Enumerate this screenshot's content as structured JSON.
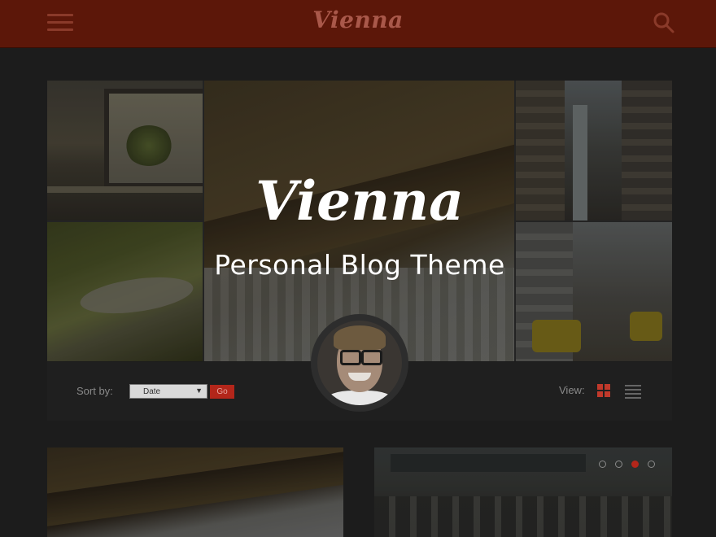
{
  "header": {
    "brand": "Vienna",
    "menu_icon": "hamburger-menu-icon",
    "search_icon": "search-icon"
  },
  "hero": {
    "brand": "Vienna",
    "tagline": "Personal Blog Theme"
  },
  "toolbar": {
    "sort_label": "Sort by:",
    "sort_value": "Date",
    "go_label": "Go",
    "view_label": "View:"
  },
  "slider": {
    "dot_count": 4,
    "active_index": 2
  },
  "colors": {
    "header_bg": "#5c1709",
    "accent": "#b3261a",
    "page_bg": "#1c1c1c"
  }
}
